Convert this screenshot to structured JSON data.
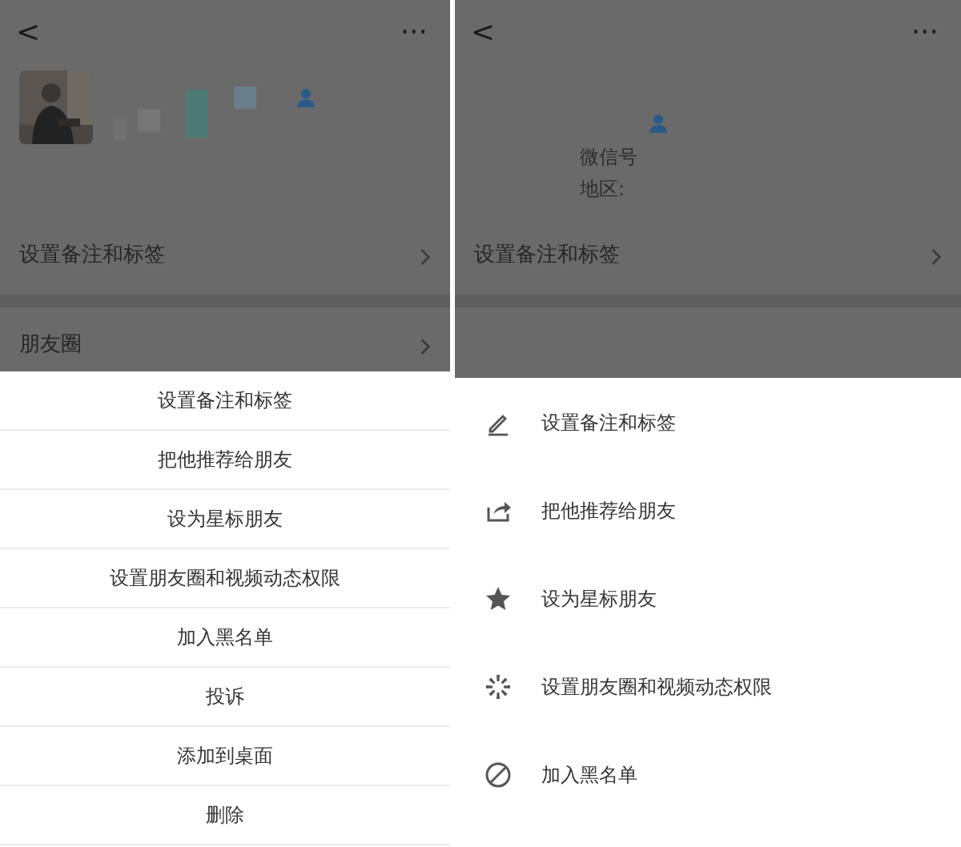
{
  "screens": [
    {
      "header": {
        "back": "<",
        "more": "···"
      },
      "rows": [
        {
          "label": "设置备注和标签"
        },
        {
          "label": "朋友圈"
        }
      ],
      "sheet": {
        "kind": "centered",
        "items": [
          {
            "label": "设置备注和标签"
          },
          {
            "label": "把他推荐给朋友"
          },
          {
            "label": "设为星标朋友"
          },
          {
            "label": "设置朋友圈和视频动态权限"
          },
          {
            "label": "加入黑名单"
          },
          {
            "label": "投诉"
          },
          {
            "label": "添加到桌面"
          },
          {
            "label": "删除"
          }
        ]
      }
    },
    {
      "header": {
        "back": "<",
        "more": "···"
      },
      "profile": {
        "kind": "blank",
        "labels": [
          "微信号",
          "地区:"
        ]
      },
      "rows": [
        {
          "label": "设置备注和标签"
        }
      ],
      "sheet": {
        "kind": "icons",
        "items": [
          {
            "label": "设置备注和标签"
          },
          {
            "label": "把他推荐给朋友"
          },
          {
            "label": "设为星标朋友"
          },
          {
            "label": "设置朋友圈和视频动态权限"
          },
          {
            "label": "加入黑名单"
          }
        ]
      }
    }
  ]
}
